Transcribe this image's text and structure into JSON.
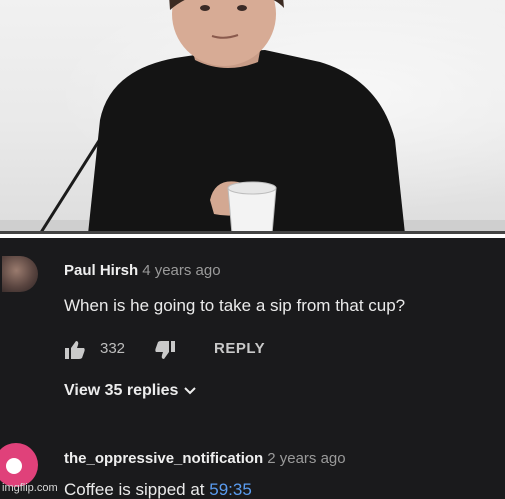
{
  "comment_1": {
    "author": "Paul Hirsh",
    "time": "4 years ago",
    "text": "When is he going to take a sip from that cup?",
    "likes": "332",
    "reply_label": "REPLY",
    "view_replies": "View 35 replies"
  },
  "comment_2": {
    "author": "the_oppressive_notification",
    "time": "2 years ago",
    "text_prefix": "Coffee is sipped at ",
    "timestamp_link": "59:35"
  },
  "watermark": "imgflip.com",
  "colors": {
    "panel_bg": "#1a1a1c",
    "link_blue": "#5a9cf0",
    "avatar_pink": "#e0417a"
  }
}
